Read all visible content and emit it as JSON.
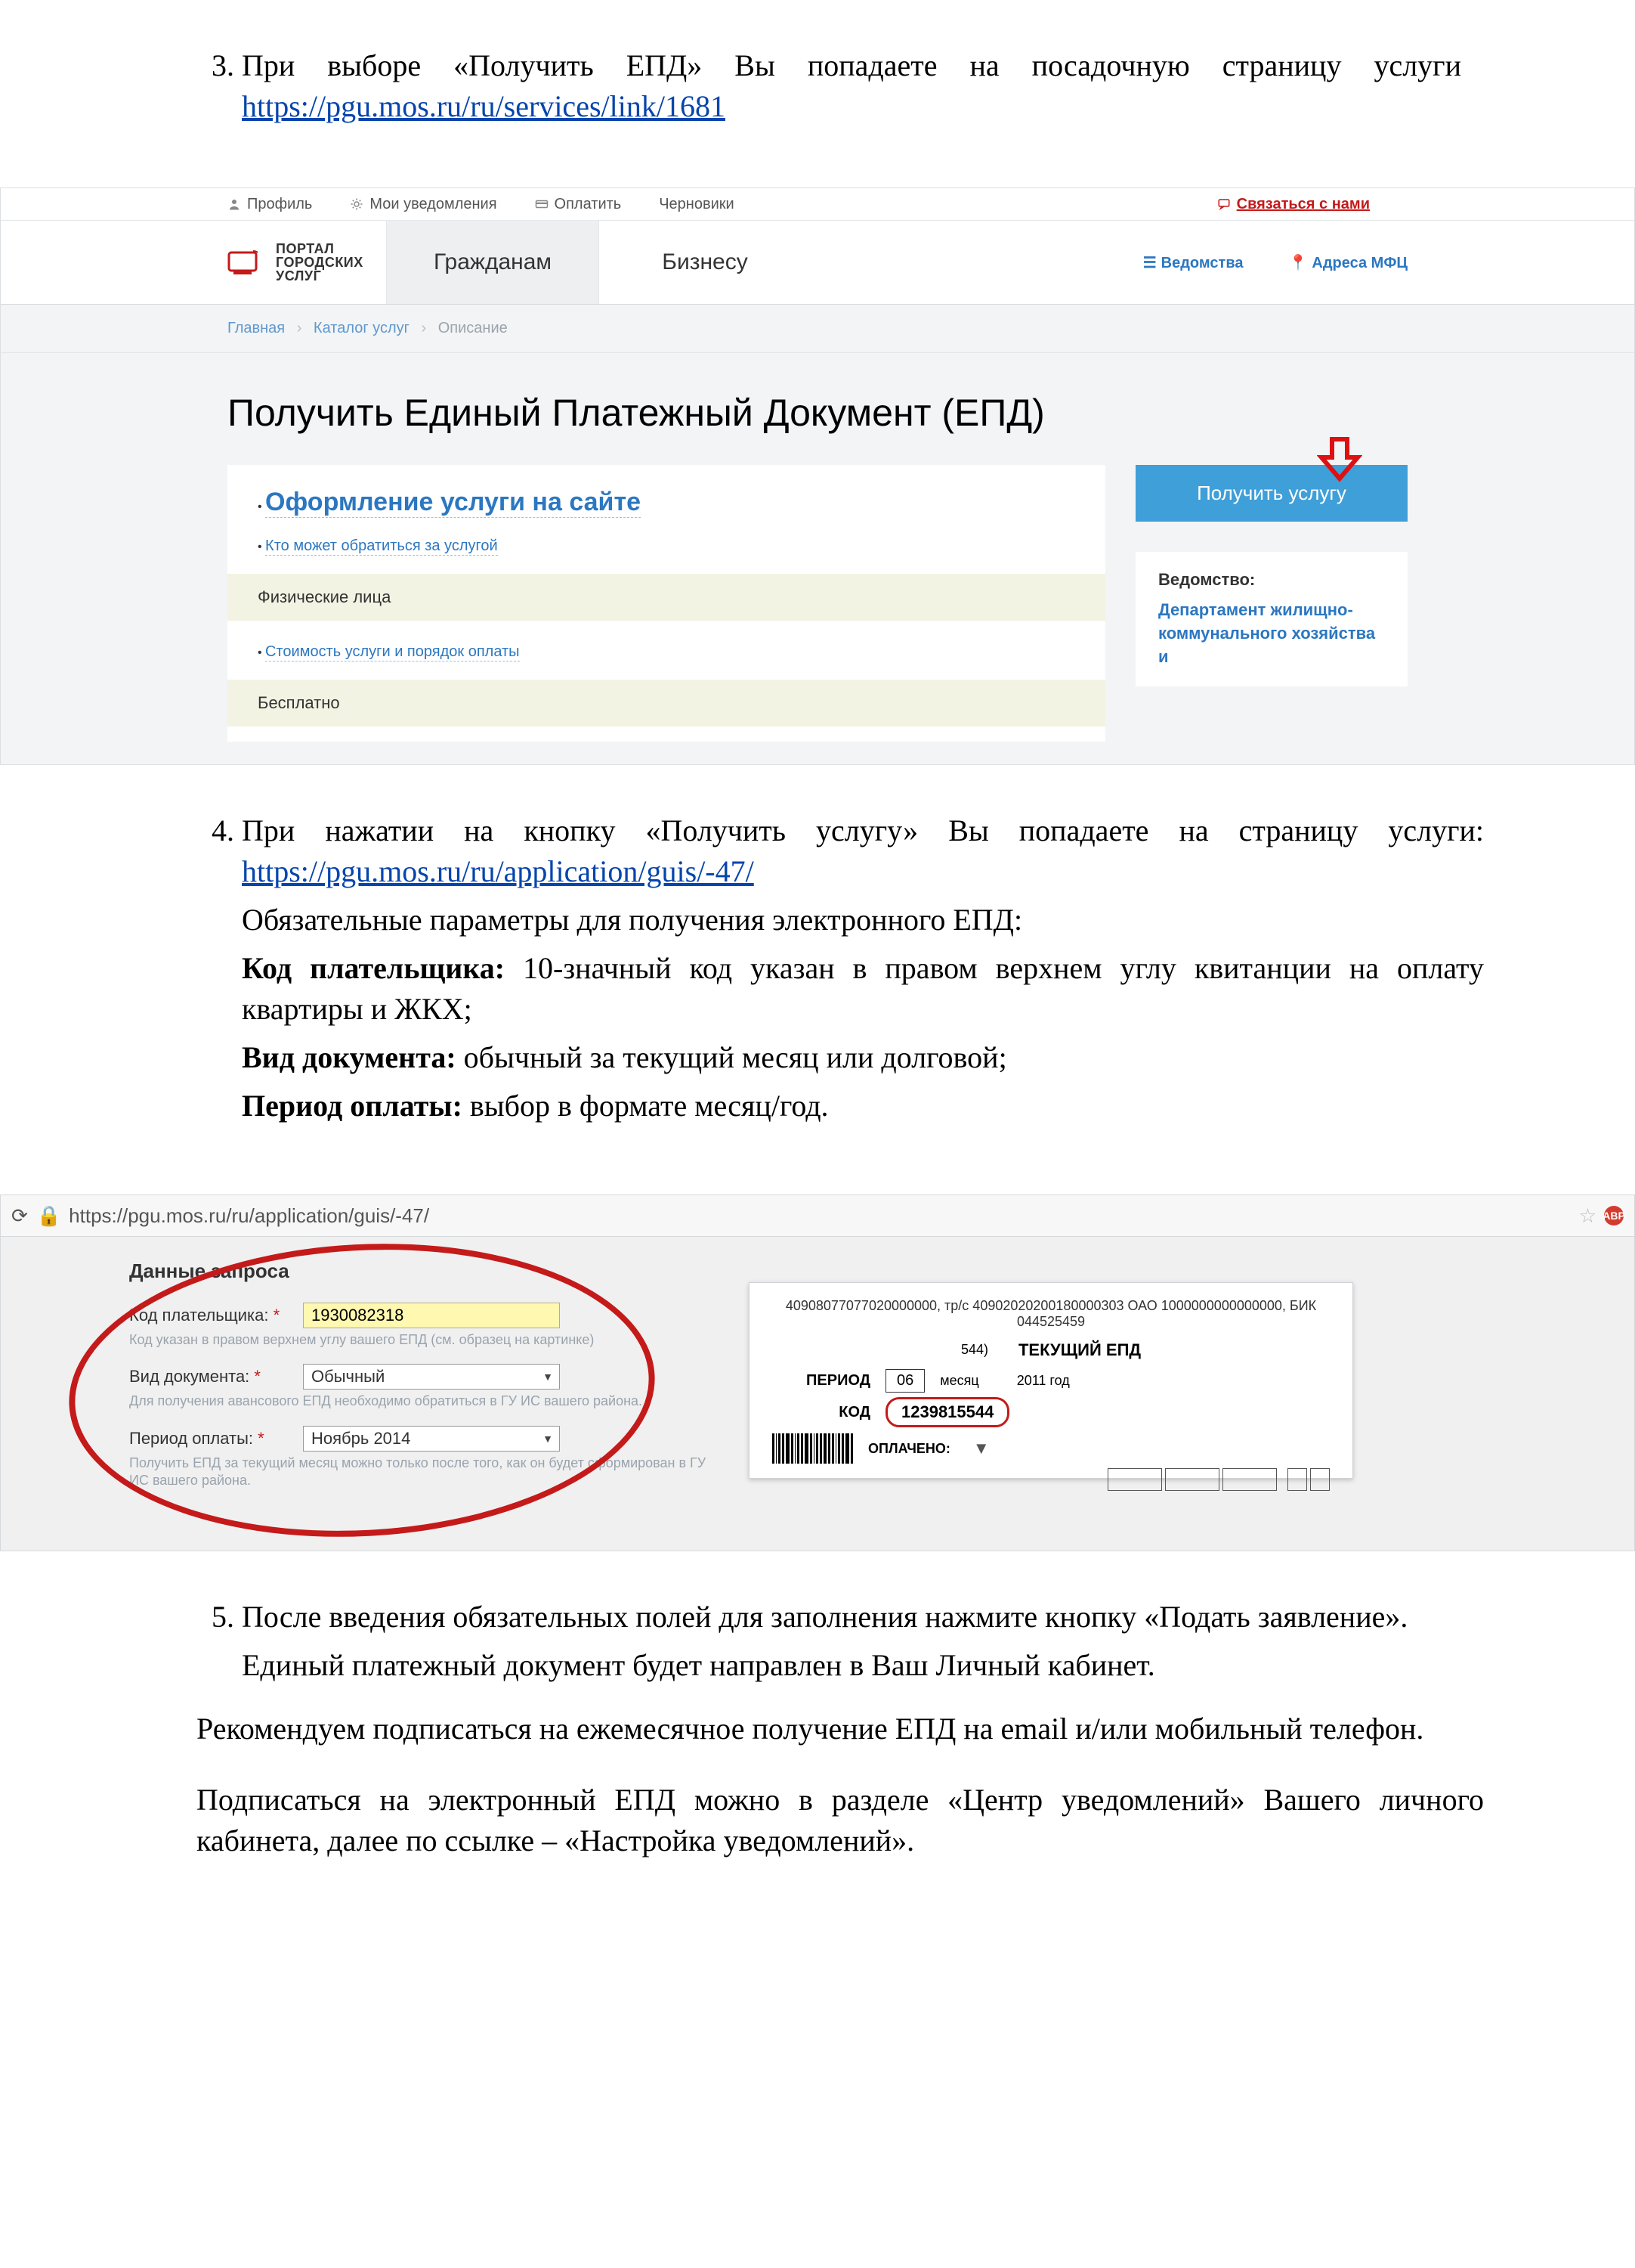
{
  "doc": {
    "item3": {
      "num": "3.",
      "text_a": "При выборе «Получить ЕПД» Вы попадаете на посадочную страницу услуги ",
      "link": "https://pgu.mos.ru/ru/services/link/1681"
    },
    "item4": {
      "num": "4.",
      "line1_a": "При нажатии на кнопку «Получить услугу» Вы попадаете на страницу услуги: ",
      "link": "https://pgu.mos.ru/ru/application/guis/-47/",
      "line2": "Обязательные параметры для получения электронного ЕПД:",
      "kp_label": "Код плательщика:",
      "kp_text": " 10-значный код указан в правом верхнем углу квитанции на оплату квартиры и ЖКХ;",
      "vd_label": "Вид документа:",
      "vd_text": " обычный за текущий месяц или долговой;",
      "po_label": "Период оплаты:",
      "po_text": " выбор в формате месяц/год."
    },
    "item5": {
      "num": "5.",
      "line1": "После введения обязательных полей для заполнения нажмите кнопку «Подать заявление».",
      "line2": "Единый платежный документ будет направлен в Ваш Личный кабинет."
    },
    "rec1": "Рекомендуем подписаться на ежемесячное получение ЕПД на email и/или мобильный телефон.",
    "rec2": "Подписаться на электронный ЕПД можно в разделе «Центр уведомлений» Вашего личного кабинета, далее по ссылке – «Настройка уведомлений»."
  },
  "portal": {
    "topbar": {
      "profile": "Профиль",
      "notifications": "Мои уведомления",
      "pay": "Оплатить",
      "drafts": "Черновики",
      "contact": "Связаться с нами"
    },
    "logo_text": "ПОРТАЛ\nГОРОДСКИХ\nУСЛУГ",
    "tabs": {
      "citizens": "Гражданам",
      "business": "Бизнесу"
    },
    "rightnav": {
      "agencies": "Ведомства",
      "mfc": "Адреса МФЦ"
    },
    "bc": {
      "home": "Главная",
      "catalog": "Каталог услуг",
      "desc": "Описание"
    },
    "title": "Получить Единый Платежный Документ (ЕПД)",
    "section_title": "Оформление услуги на сайте",
    "who_link": "Кто может обратиться за услугой",
    "phys": "Физические лица",
    "cost_link": "Стоимость услуги и порядок оплаты",
    "free": "Бесплатно",
    "get_btn": "Получить услугу",
    "ved_label": "Ведомство:",
    "ved_text": "Департамент жилищно-коммунального хозяйства и"
  },
  "browser": {
    "url": "https://pgu.mos.ru/ru/application/guis/-47/",
    "form": {
      "title": "Данные запроса",
      "kp_label": "Код плательщика:",
      "kp_value": "1930082318",
      "kp_hint": "Код указан в правом верхнем углу вашего ЕПД (см. образец на картинке)",
      "vd_label": "Вид документа:",
      "vd_value": "Обычный",
      "vd_hint": "Для получения авансового ЕПД необходимо обратиться в ГУ ИС вашего района.",
      "po_label": "Период оплаты:",
      "po_value": "Ноябрь 2014",
      "po_hint": "Получить ЕПД за текущий месяц можно только после того, как он будет сформирован в ГУ ИС вашего района."
    },
    "receipt": {
      "bank_line": "40908077077020000000, тр/с 40902020200180000303 ОАО 1000000000000000, БИК 044525459",
      "acct": "544)",
      "title": "ТЕКУЩИЙ ЕПД",
      "period_label": "ПЕРИОД",
      "month": "06",
      "month_label": "месяц",
      "year": "2011 год",
      "code_label": "КОД",
      "code": "1239815544",
      "paid_label": "ОПЛАЧЕНО:"
    }
  }
}
